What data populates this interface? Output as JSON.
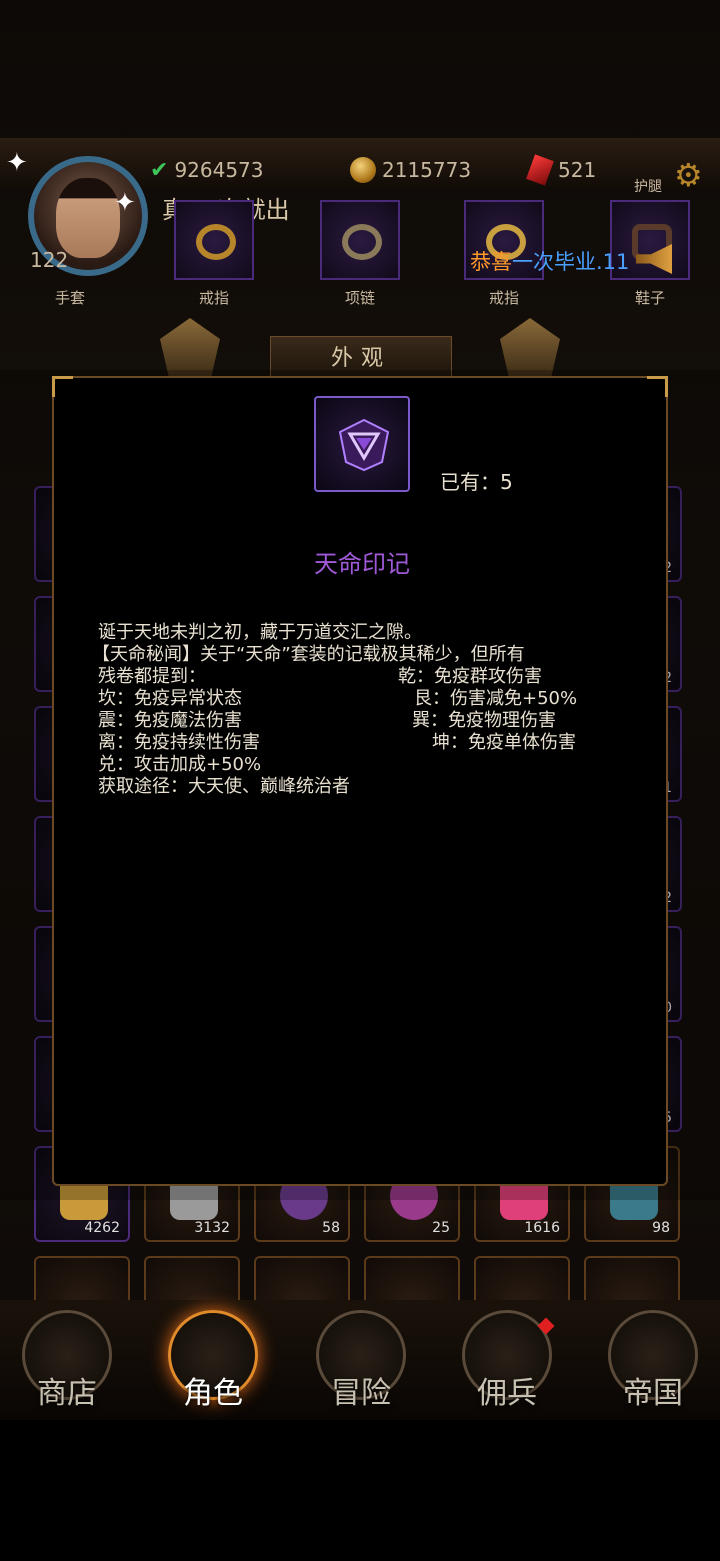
{
  "resources": {
    "gold_value": "9264573",
    "coin_value": "2115773",
    "gem_value": "521"
  },
  "player": {
    "level": "122",
    "title": "真·一次就出"
  },
  "equipment": {
    "slots": [
      {
        "label": "手套"
      },
      {
        "label": "戒指"
      },
      {
        "label": "项链"
      },
      {
        "label": "戒指"
      },
      {
        "label": "鞋子"
      }
    ],
    "top_right_label": "护腿"
  },
  "announcement": {
    "part_a": "恭喜",
    "part_b": "一次毕业.11"
  },
  "section_tab": "外观",
  "inventory": {
    "visible_counts": [
      "4262",
      "3132",
      "58",
      "25",
      "1616",
      "98"
    ],
    "right_edge_counts": [
      "2",
      "2",
      "1",
      "2",
      "0",
      "5"
    ]
  },
  "nav": {
    "items": [
      {
        "label": "商店"
      },
      {
        "label": "角色"
      },
      {
        "label": "冒险"
      },
      {
        "label": "佣兵"
      },
      {
        "label": "帝国"
      }
    ],
    "active": "角色"
  },
  "item_detail": {
    "owned_text": "已有：5",
    "name": "天命印记",
    "name_color": "#a05ad8",
    "lore_1": "诞于天地未判之初，藏于万道交汇之隙。",
    "lore_2": "【天命秘闻】关于“天命”套装的记载极其稀少，但所有",
    "lore_3_left": "残卷都提到：",
    "lore_3_right": "乾：免疫群攻伤害",
    "row_kan": "坎：免疫异常状态",
    "row_gen": "艮：伤害减免+50%",
    "row_zhen": "震：免疫魔法伤害",
    "row_xun": "巽：免疫物理伤害",
    "row_li": "离：免疫持续性伤害",
    "row_kun": "坤：免疫单体伤害",
    "row_dui": "兑：攻击加成+50%",
    "source": "获取途径：大天使、巅峰统治者"
  }
}
